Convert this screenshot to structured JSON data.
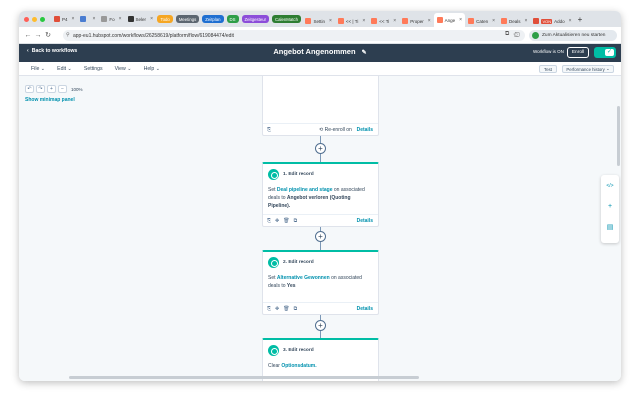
{
  "browser": {
    "tabs": [
      {
        "label": "P4",
        "color": "#e04e39"
      },
      {
        "label": "",
        "color": "#4a7dd1"
      },
      {
        "label": "Fo",
        "color": "#999999"
      },
      {
        "label": "Seler",
        "color": "#333333"
      }
    ],
    "pills": [
      {
        "label": "Todo",
        "color": "#f5a623"
      },
      {
        "label": "Meetings",
        "color": "#5c6670"
      },
      {
        "label": "Zeitplan",
        "color": "#1f6fd1"
      },
      {
        "label": "DS",
        "color": "#2e9e47"
      },
      {
        "label": "Zeitgesteur",
        "color": "#8c4dd9"
      },
      {
        "label": "CalenMatch",
        "color": "#2e7d32"
      }
    ],
    "tabs_after": [
      {
        "label": "Settin",
        "color": "#ff7a59"
      },
      {
        "label": "<< | Ti",
        "color": "#ff7a59"
      },
      {
        "label": "<< Ti",
        "color": "#ff7a59"
      },
      {
        "label": "Proper",
        "color": "#ff7a59"
      },
      {
        "label": "Ange",
        "color": "#ff7a59",
        "active": true
      },
      {
        "label": "Caten",
        "color": "#ff7a59"
      },
      {
        "label": "Deals",
        "color": "#ff7a59"
      },
      {
        "label": "Addo",
        "color": "#e04e39",
        "badge": "VON"
      }
    ],
    "close_glyph": "×",
    "newtab_glyph": "+",
    "url": "app-eu1.hubspot.com/workflows/26258619/platform/flow/619084474/edit",
    "update_label": "Zum Aktualisieren neu starten"
  },
  "header": {
    "back_label": "Back to workflows",
    "title": "Angebot Angenommen",
    "status": "Workflow is ON",
    "enroll_label": "Enroll",
    "toggle_glyph": "✓"
  },
  "menu": {
    "items": [
      "File",
      "Edit",
      "Settings",
      "View",
      "Help"
    ],
    "test_label": "Test",
    "performance_label": "Performance history"
  },
  "canvas": {
    "zoom_level": "100%",
    "minimap_label": "Show minimap panel",
    "first_card": {
      "reenroll_label": "Re-enroll on",
      "details_label": "Details"
    },
    "actions": [
      {
        "title": "1. Edit record",
        "segments": [
          {
            "text": "Set ",
            "style": "plain"
          },
          {
            "text": "Deal pipeline and stage",
            "style": "link"
          },
          {
            "text": " on associated deals to ",
            "style": "plain"
          },
          {
            "text": "Angebot verloren (Quoting Pipeline).",
            "style": "bold"
          }
        ],
        "details_label": "Details"
      },
      {
        "title": "2. Edit record",
        "segments": [
          {
            "text": "Set ",
            "style": "plain"
          },
          {
            "text": "Alternative Gewonnen",
            "style": "link"
          },
          {
            "text": " on associated deals to ",
            "style": "plain"
          },
          {
            "text": "Yes",
            "style": "bold"
          }
        ],
        "details_label": "Details"
      },
      {
        "title": "3. Edit record",
        "segments": [
          {
            "text": "Clear ",
            "style": "plain"
          },
          {
            "text": "Optionsdatum.",
            "style": "link"
          }
        ],
        "details_label": ""
      }
    ]
  }
}
